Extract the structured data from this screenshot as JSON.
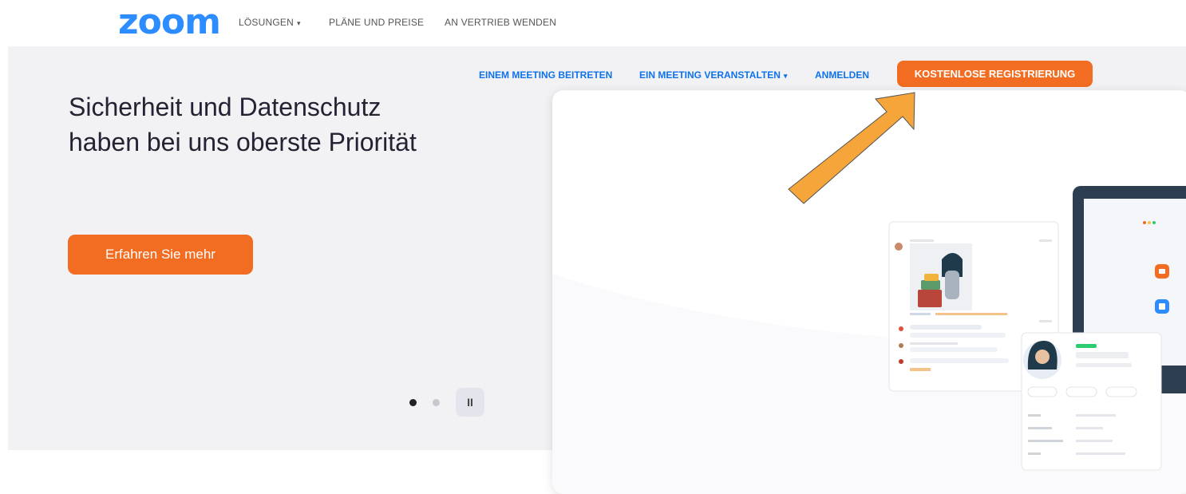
{
  "nav": {
    "logo": "zoom",
    "items": [
      {
        "label": "LÖSUNGEN",
        "caret": "▾"
      },
      {
        "label": "PLÄNE UND PREISE"
      },
      {
        "label": "AN VERTRIEB WENDEN"
      }
    ]
  },
  "hero_nav": {
    "join": "EINEM MEETING BEITRETEN",
    "host": "EIN MEETING VERANSTALTEN",
    "host_caret": "▾",
    "signin": "ANMELDEN",
    "signup": "KOSTENLOSE REGISTRIERUNG"
  },
  "hero": {
    "headline": "Sicherheit und Datenschutz haben bei uns oberste Priorität",
    "cta": "Erfahren Sie mehr",
    "pause_label": "II"
  },
  "colors": {
    "brand_blue": "#2d8cff",
    "link_blue": "#0e72ed",
    "accent_orange": "#f26d21",
    "arrow_orange": "#f6a53a",
    "hero_bg": "#f2f2f4",
    "dark_frame": "#2c3e50",
    "status_green": "#2ecc71"
  }
}
